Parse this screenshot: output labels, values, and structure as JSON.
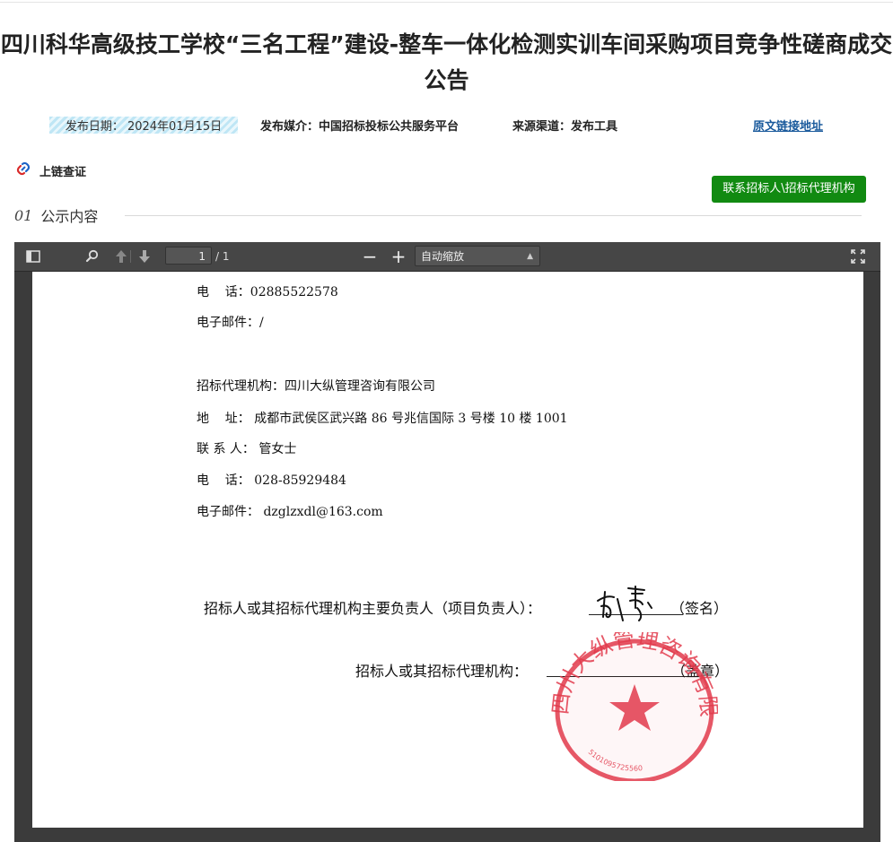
{
  "header": {
    "title_line1": "四川科华高级技工学校“三名工程”建设-整车一体化检测实训车间采购项目竞争性磋商成交",
    "title_line2": "公告"
  },
  "meta": {
    "publish_date": "发布日期： 2024年01月15日",
    "media": "发布媒介：中国招标投标公共服务平台",
    "source": "来源渠道：发布工具",
    "original_link": "原文链接地址"
  },
  "actions": {
    "blockchain": "上链查证",
    "contact_button": "联系招标人\\招标代理机构"
  },
  "section": {
    "number": "01",
    "title": "公示内容"
  },
  "pdf_toolbar": {
    "page_current": "1",
    "page_count": "/ 1",
    "zoom_out": "−",
    "zoom_in": "+",
    "zoom_mode": "自动缩放"
  },
  "document": {
    "phone1": "电    话：02885522578",
    "email1": "电子邮件：/",
    "agency": "招标代理机构：四川大纵管理咨询有限公司",
    "address": "地    址： 成都市武侯区武兴路 86 号兆信国际 3 号楼 10 楼 1001",
    "contact": "联 系 人： 管女士",
    "phone2": "电    话： 028-85929484",
    "email2": "电子邮件： dzglzxdl@163.com",
    "sign_leader_label": "招标人或其招标代理机构主要负责人（项目负责人）：",
    "sign_leader_suffix": "（签名）",
    "sign_org_label": "招标人或其招标代理机构：",
    "sign_org_suffix": "（盖章）",
    "seal_text": "四川大纵管理咨询有限公司",
    "seal_number": "5101095725560"
  },
  "colors": {
    "button_green": "#118a11",
    "link_blue": "#1a5a9c",
    "seal_red": "#e23a4c",
    "viewer_bg": "#3b3b3b"
  }
}
